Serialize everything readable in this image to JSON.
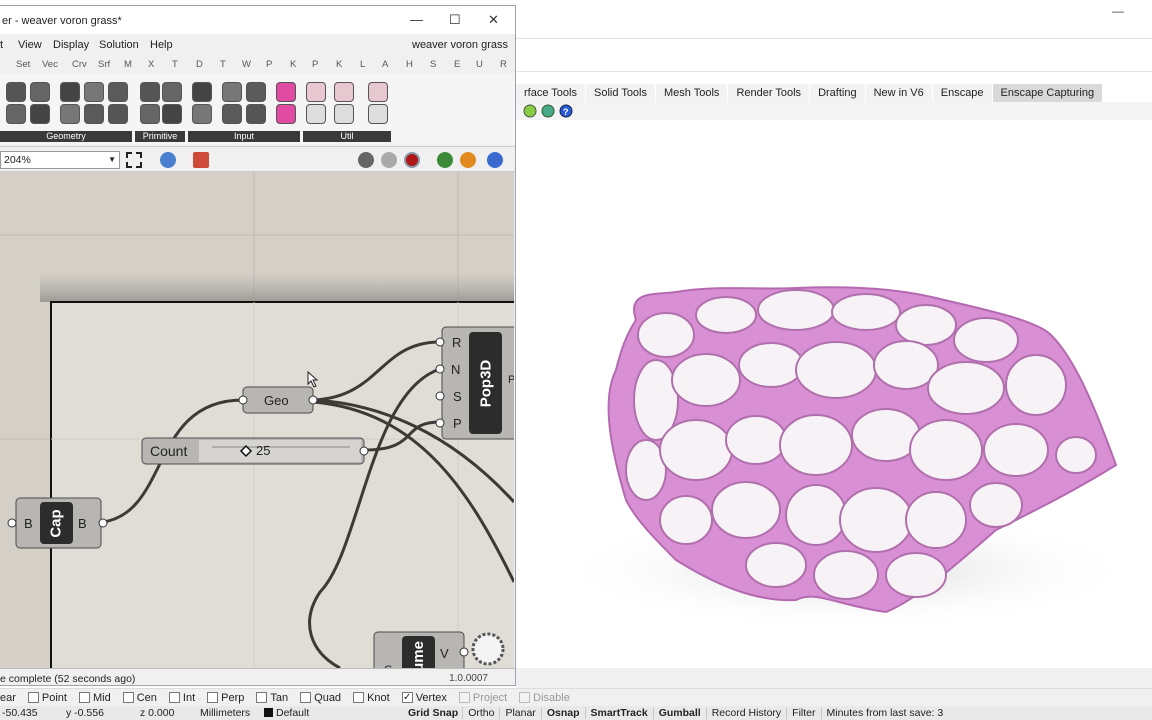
{
  "grasshopper": {
    "window_title": "er - weaver voron grass*",
    "menu": [
      "t",
      "View",
      "Display",
      "Solution",
      "Help"
    ],
    "document_name": "weaver voron grass",
    "categories": [
      "Set",
      "Vec",
      "Crv",
      "Srf",
      "M",
      "X",
      "T",
      "D",
      "T",
      "W",
      "P",
      "K",
      "P",
      "K",
      "L",
      "A",
      "H",
      "S",
      "E",
      "U",
      "R"
    ],
    "ribbon_groups": [
      "Geometry",
      "Primitive",
      "Input",
      "Util"
    ],
    "zoom": "204%",
    "status_message": "e complete (52 seconds ago)",
    "version": "1.0.0007"
  },
  "canvas": {
    "geo_label": "Geo",
    "count_label": "Count",
    "count_value": "25",
    "cap_label": "Cap",
    "cap_in": "B",
    "cap_out": "B",
    "pop3d_label": "Pop3D",
    "pop3d_inputs": [
      "R",
      "N",
      "S",
      "P"
    ],
    "pop3d_output": "P",
    "bottom_label": "ume",
    "bottom_in": "G",
    "bottom_out": "V"
  },
  "rhino": {
    "tabs": [
      "rface Tools",
      "Solid Tools",
      "Mesh Tools",
      "Render Tools",
      "Drafting",
      "New in V6",
      "Enscape",
      "Enscape Capturing"
    ],
    "osnap": [
      {
        "label": "ear",
        "checked": false,
        "disabled": false
      },
      {
        "label": "Point",
        "checked": false,
        "disabled": false
      },
      {
        "label": "Mid",
        "checked": false,
        "disabled": false
      },
      {
        "label": "Cen",
        "checked": false,
        "disabled": false
      },
      {
        "label": "Int",
        "checked": false,
        "disabled": false
      },
      {
        "label": "Perp",
        "checked": false,
        "disabled": false
      },
      {
        "label": "Tan",
        "checked": false,
        "disabled": false
      },
      {
        "label": "Quad",
        "checked": false,
        "disabled": false
      },
      {
        "label": "Knot",
        "checked": false,
        "disabled": false
      },
      {
        "label": "Vertex",
        "checked": true,
        "disabled": false
      },
      {
        "label": "Project",
        "checked": false,
        "disabled": true
      },
      {
        "label": "Disable",
        "checked": false,
        "disabled": true
      }
    ],
    "status": {
      "x": "-50.435",
      "y": "y -0.556",
      "z": "z 0.000",
      "units": "Millimeters",
      "layer": "Default",
      "grid_snap": "Grid Snap",
      "ortho": "Ortho",
      "planar": "Planar",
      "osnap": "Osnap",
      "smarttrack": "SmartTrack",
      "gumball": "Gumball",
      "record_history": "Record History",
      "filter": "Filter",
      "last_save": "Minutes from last save: 3"
    },
    "model_color": "#d88fd4"
  }
}
